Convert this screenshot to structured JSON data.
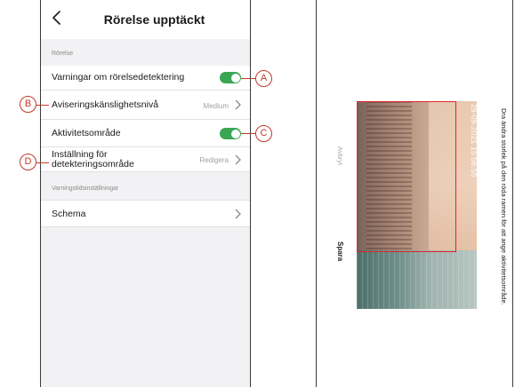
{
  "left_screen": {
    "title": "Rörelse upptäckt",
    "section_motion": "Rörelse",
    "rows": {
      "motion_alerts": {
        "label": "Varningar om rörelsedetektering",
        "toggle_on": true
      },
      "sensitivity": {
        "label": "Aviseringskänslighetsnivå",
        "value": "Medium"
      },
      "activity_zone": {
        "label": "Aktivitetsområde",
        "toggle_on": true
      },
      "detection_zone": {
        "label_line1": "Inställning för",
        "label_line2": "detekteringsområde",
        "value": "Redigera"
      }
    },
    "section_alert_time": "Varningstidsinställningar",
    "schedule": {
      "label": "Schema"
    }
  },
  "callouts": {
    "a": "A",
    "b": "B",
    "c": "C",
    "d": "D"
  },
  "right_screen": {
    "instruction": "Dra ändra storlek på den röda ramen för att ange aktivitetsområde.",
    "cancel": "Avbryt",
    "save": "Spara",
    "timestamp": "29-09-2021 15:56:55"
  },
  "colors": {
    "toggle_on": "#3aa655",
    "callout": "#c0392b",
    "detection_frame": "#e0242a"
  }
}
